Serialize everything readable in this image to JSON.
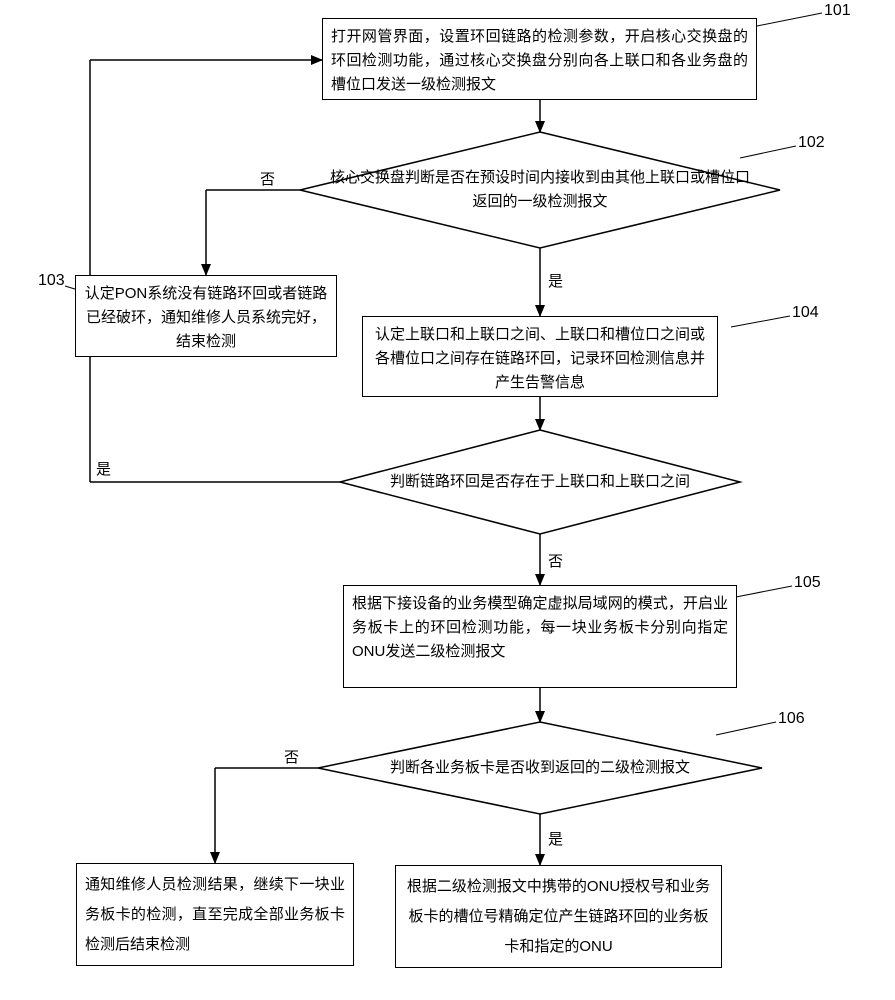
{
  "chart_data": {
    "type": "flowchart",
    "title": "",
    "nodes": [
      {
        "id": 101,
        "type": "process",
        "text": "打开网管界面，设置环回链路的检测参数，开启核心交换盘的环回检测功能，通过核心交换盘分别向各上联口和各业务盘的槽位口发送一级检测报文"
      },
      {
        "id": 102,
        "type": "decision",
        "text": "核心交换盘判断是否在预设时间内接收到由其他上联口或槽位口返回的一级检测报文"
      },
      {
        "id": 103,
        "type": "process",
        "text": "认定PON系统没有链路环回或者链路已经破环，通知维修人员系统完好，结束检测"
      },
      {
        "id": 104,
        "type": "process",
        "text": "认定上联口和上联口之间、上联口和槽位口之间或各槽位口之间存在链路环回，记录环回检测信息并产生告警信息"
      },
      {
        "id": "d2",
        "type": "decision",
        "text": "判断链路环回是否存在于上联口和上联口之间"
      },
      {
        "id": 105,
        "type": "process",
        "text": "根据下接设备的业务模型确定虚拟局域网的模式，开启业务板卡上的环回检测功能，每一块业务板卡分别向指定ONU发送二级检测报文"
      },
      {
        "id": 106,
        "type": "decision",
        "text": "判断各业务板卡是否收到返回的二级检测报文"
      },
      {
        "id": 107,
        "type": "process",
        "text": "通知维修人员检测结果，继续下一块业务板卡的检测，直至完成全部业务板卡检测后结束检测"
      },
      {
        "id": 108,
        "type": "process",
        "text": "根据二级检测报文中携带的ONU授权号和业务板卡的槽位号精确定位产生链路环回的业务板卡和指定的ONU"
      }
    ],
    "edges": [
      {
        "from": 101,
        "to": 102
      },
      {
        "from": 102,
        "to": 103,
        "label": "否"
      },
      {
        "from": 102,
        "to": 104,
        "label": "是"
      },
      {
        "from": 104,
        "to": "d2"
      },
      {
        "from": "d2",
        "to": 101,
        "label": "是"
      },
      {
        "from": "d2",
        "to": 105,
        "label": "否"
      },
      {
        "from": 105,
        "to": 106
      },
      {
        "from": 106,
        "to": 107,
        "label": "否"
      },
      {
        "from": 106,
        "to": 108,
        "label": "是"
      }
    ]
  },
  "labels": {
    "yes": "是",
    "no": "否"
  },
  "refs": {
    "r101": "101",
    "r102": "102",
    "r103": "103",
    "r104": "104",
    "r105": "105",
    "r106": "106"
  },
  "nodes": {
    "n101": "打开网管界面，设置环回链路的检测参数，开启核心交换盘的环回检测功能，通过核心交换盘分别向各上联口和各业务盘的槽位口发送一级检测报文",
    "n102": "核心交换盘判断是否在预设时间内接收到由其他上联口或槽位口返回的一级检测报文",
    "n103": "认定PON系统没有链路环回或者链路已经破环，通知维修人员系统完好，结束检测",
    "n104": "认定上联口和上联口之间、上联口和槽位口之间或各槽位口之间存在链路环回，记录环回检测信息并产生告警信息",
    "nd2": "判断链路环回是否存在于上联口和上联口之间",
    "n105": "根据下接设备的业务模型确定虚拟局域网的模式，开启业务板卡上的环回检测功能，每一块业务板卡分别向指定ONU发送二级检测报文",
    "n106": "判断各业务板卡是否收到返回的二级检测报文",
    "n107": "通知维修人员检测结果，继续下一块业务板卡的检测，直至完成全部业务板卡检测后结束检测",
    "n108": "根据二级检测报文中携带的ONU授权号和业务板卡的槽位号精确定位产生链路环回的业务板卡和指定的ONU"
  }
}
